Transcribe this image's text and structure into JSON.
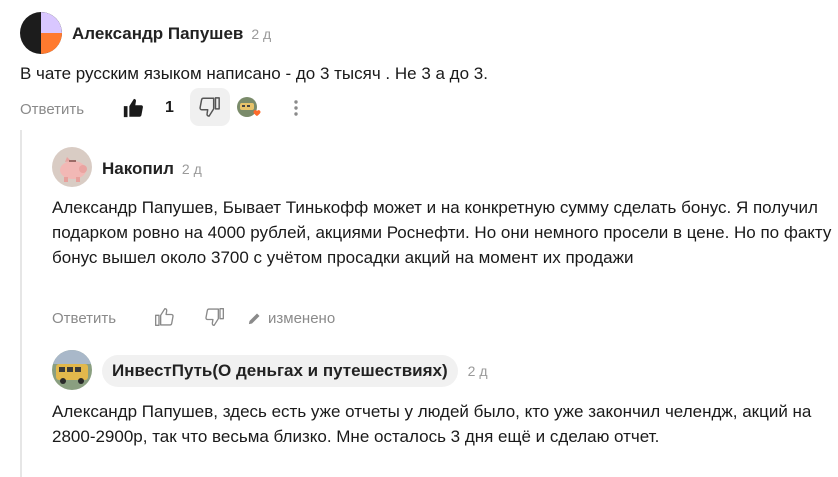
{
  "comments": [
    {
      "author": "Александр Папушев",
      "time": "2 д",
      "text": "В чате русским языком написано - до 3 тысяч . Не 3 а до 3.",
      "reply_label": "Ответить",
      "like_count": "1",
      "avatar_icon": "half-moon-orange-avatar",
      "reaction_icon": "reaction-heart-avatar"
    },
    {
      "author": "Накопил",
      "time": "2 д",
      "text": "Александр Папушев, Бывает Тинькофф может и на конкретную сумму сделать бонус. Я получил подарком ровно на 4000 рублей, акциями Роснефти. Но они немного просели в цене. Но по факту бонус вышел около 3700 с учётом просадки акций на момент их продажи",
      "reply_label": "Ответить",
      "edited_label": "изменено",
      "avatar_icon": "piggy-bank-avatar"
    },
    {
      "author": "ИнвестПуть(О деньгах и путешествиях)",
      "time": "2 д",
      "text": "Александр Папушев, здесь есть уже отчеты у людей было, кто уже закончил челендж, акций на 2800-2900р, так что весьма близко. Мне осталось 3 дня ещё и сделаю отчет.",
      "avatar_icon": "bus-avatar"
    }
  ],
  "colors": {
    "accent_orange": "#ff7a2f",
    "avatar_dark": "#1c1c1c",
    "avatar_lilac": "#d9c7ff",
    "muted": "#8a8a8a",
    "thread_line": "#e6e6e6"
  }
}
